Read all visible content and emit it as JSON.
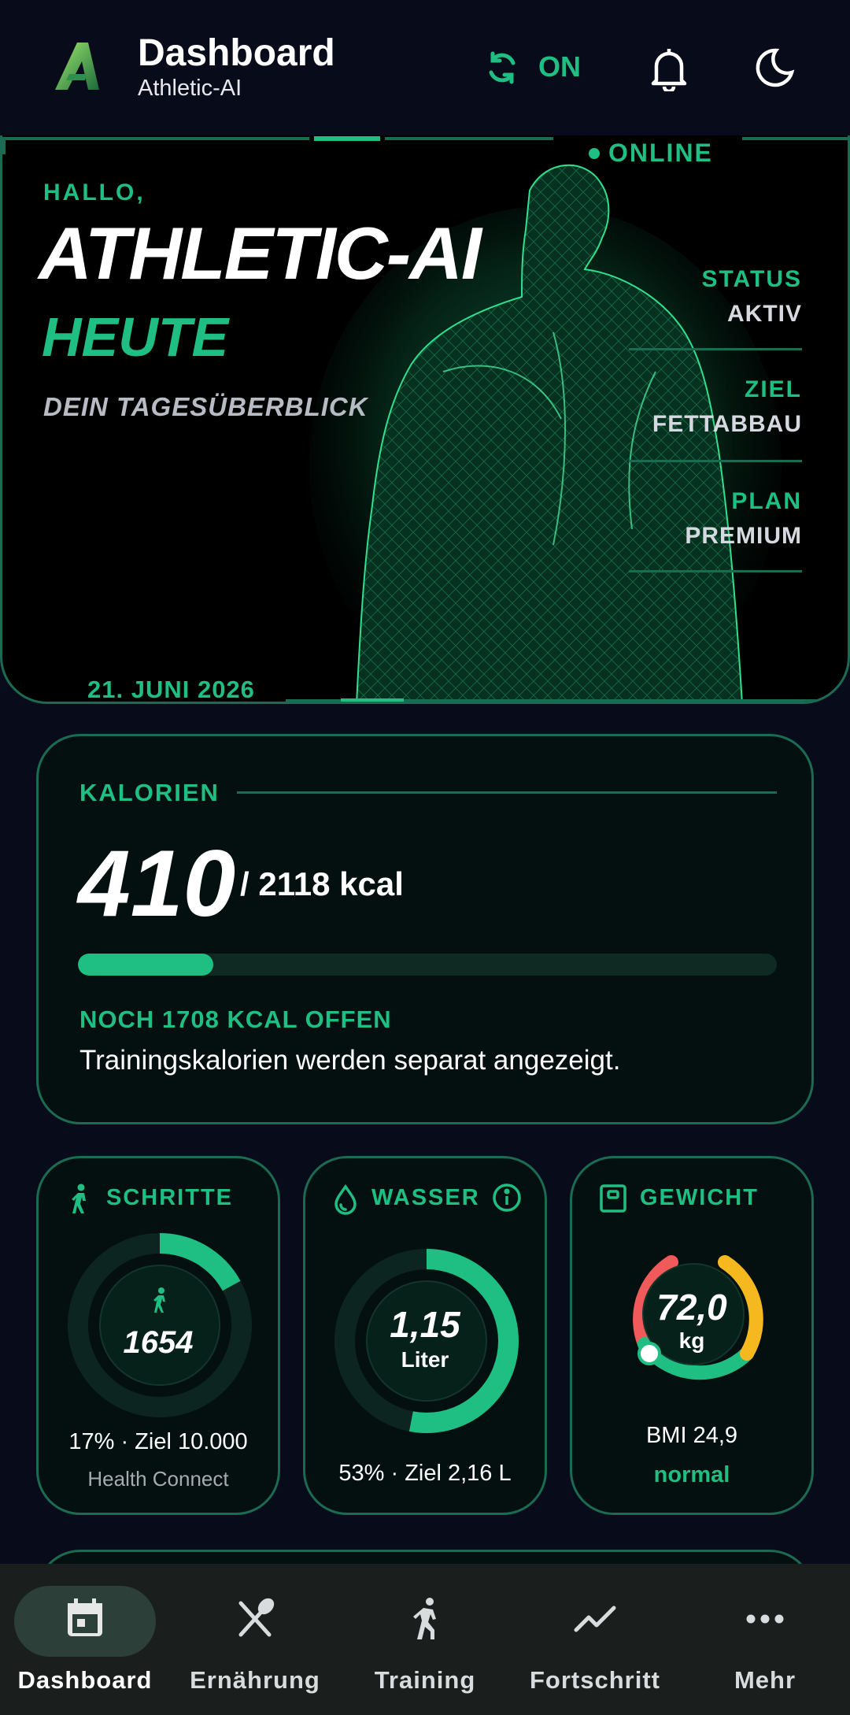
{
  "header": {
    "title": "Dashboard",
    "subtitle": "Athletic-AI",
    "sync_label": "ON",
    "icons": [
      "logo-icon",
      "sync-icon",
      "bell-icon",
      "moon-icon"
    ]
  },
  "hero": {
    "online_label": "ONLINE",
    "greeting": "HALLO,",
    "title": "ATHLETIC-AI",
    "today": "HEUTE",
    "subtitle": "DEIN TAGESÜBERBLICK",
    "stats": [
      {
        "label": "STATUS",
        "value": "AKTIV"
      },
      {
        "label": "ZIEL",
        "value": "FETTABBAU"
      },
      {
        "label": "PLAN",
        "value": "PREMIUM"
      }
    ],
    "date": "21. JUNI 2026"
  },
  "calories": {
    "label": "KALORIEN",
    "value": "410",
    "target": "/ 2118 kcal",
    "progress_percent": 19.4,
    "remaining": "NOCH 1708 KCAL OFFEN",
    "note": "Trainingskalorien werden separat angezeigt."
  },
  "steps": {
    "label": "SCHRITTE",
    "value": "1654",
    "progress_percent": 17,
    "goal_text": "17% · Ziel 10.000",
    "source": "Health Connect"
  },
  "water": {
    "label": "WASSER",
    "value": "1,15",
    "unit": "Liter",
    "progress_percent": 53,
    "goal_text": "53% · Ziel 2,16 L"
  },
  "weight": {
    "label": "GEWICHT",
    "value": "72,0",
    "unit": "kg",
    "bmi": "BMI 24,9",
    "bmi_class": "normal"
  },
  "nav": {
    "items": [
      {
        "label": "Dashboard",
        "icon": "calendar-icon",
        "active": true
      },
      {
        "label": "Ernährung",
        "icon": "fork-knife-icon",
        "active": false
      },
      {
        "label": "Training",
        "icon": "runner-icon",
        "active": false
      },
      {
        "label": "Fortschritt",
        "icon": "trend-chart-icon",
        "active": false
      },
      {
        "label": "Mehr",
        "icon": "more-dots-icon",
        "active": false
      }
    ]
  },
  "colors": {
    "background": "#070b1a",
    "accent": "#1fbf84",
    "border": "#1b6a52",
    "danger": "#f05a5a",
    "warning": "#f5b81f"
  }
}
